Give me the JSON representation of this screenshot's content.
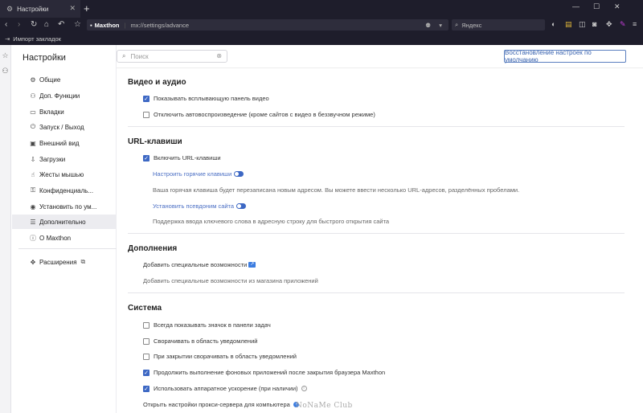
{
  "browser": {
    "tab_title": "Настройки",
    "brand": "Maxthon",
    "url": "mx://settings/advance",
    "search_placeholder": "Яндекс",
    "bookmark_item": "Импорт закладок"
  },
  "sidebar": {
    "title": "Настройки",
    "items": [
      {
        "label": "Общие",
        "icon": "gear-icon",
        "glyph": "⚙"
      },
      {
        "label": "Доп. Функции",
        "icon": "plugin-icon",
        "glyph": "⚇"
      },
      {
        "label": "Вкладки",
        "icon": "tabs-icon",
        "glyph": "▭"
      },
      {
        "label": "Запуск / Выход",
        "icon": "power-icon",
        "glyph": "⏻"
      },
      {
        "label": "Внешний вид",
        "icon": "appearance-icon",
        "glyph": "▣"
      },
      {
        "label": "Загрузки",
        "icon": "download-icon",
        "glyph": "⇩"
      },
      {
        "label": "Жесты мышью",
        "icon": "gesture-icon",
        "glyph": "☝"
      },
      {
        "label": "Конфиденциаль...",
        "icon": "lock-icon",
        "glyph": "🔒"
      },
      {
        "label": "Установить по ум...",
        "icon": "browser-icon",
        "glyph": "◉"
      },
      {
        "label": "Дополнительно",
        "icon": "menu-icon",
        "glyph": "☰"
      },
      {
        "label": "О Maxthon",
        "icon": "info-icon",
        "glyph": "ⓘ"
      }
    ],
    "extensions": {
      "label": "Расширения",
      "icon": "puzzle-icon",
      "glyph": "✥"
    }
  },
  "search": {
    "placeholder": "Поиск"
  },
  "reset_button": "Восстановление настроек по умолчанию",
  "sections": {
    "video": {
      "title": "Видео и аудио",
      "opt1": "Показывать всплывающую панель видео",
      "opt2": "Отключить автовоспроизведение (кроме сайтов с видео в беззвучном режиме)"
    },
    "url": {
      "title": "URL-клавиши",
      "opt1": "Включить URL-клавиши",
      "link1": "Настроить горячие клавиши",
      "desc1": "Ваша горячая клавиша будет перезаписана новым адресом. Вы можете ввести несколько URL-адресов, разделённых пробелами.",
      "link2": "Установить псевдоним сайта",
      "desc2": "Поддержка ввода ключевого слова в адресную строку для быстрого открытия сайта"
    },
    "addons": {
      "title": "Дополнения",
      "opt1": "Добавить специальные возможности",
      "desc1": "Добавить специальные возможности из магазина приложений"
    },
    "system": {
      "title": "Система",
      "opt1": "Всегда показывать значок в панели задач",
      "opt2": "Сворачивать в область уведомлений",
      "opt3": "При закрытии сворачивать в область уведомлений",
      "opt4": "Продолжить выполнение фоновых приложений после закрытия браузера Maxthon",
      "opt5": "Использовать аппаратное ускорение (при наличии)",
      "opt6": "Открыть настройки прокси-сервера для компьютера"
    }
  },
  "watermark": "NoNaMe Club",
  "colors": {
    "accent": "#3d68c4",
    "chrome": "#1e1d2b"
  }
}
